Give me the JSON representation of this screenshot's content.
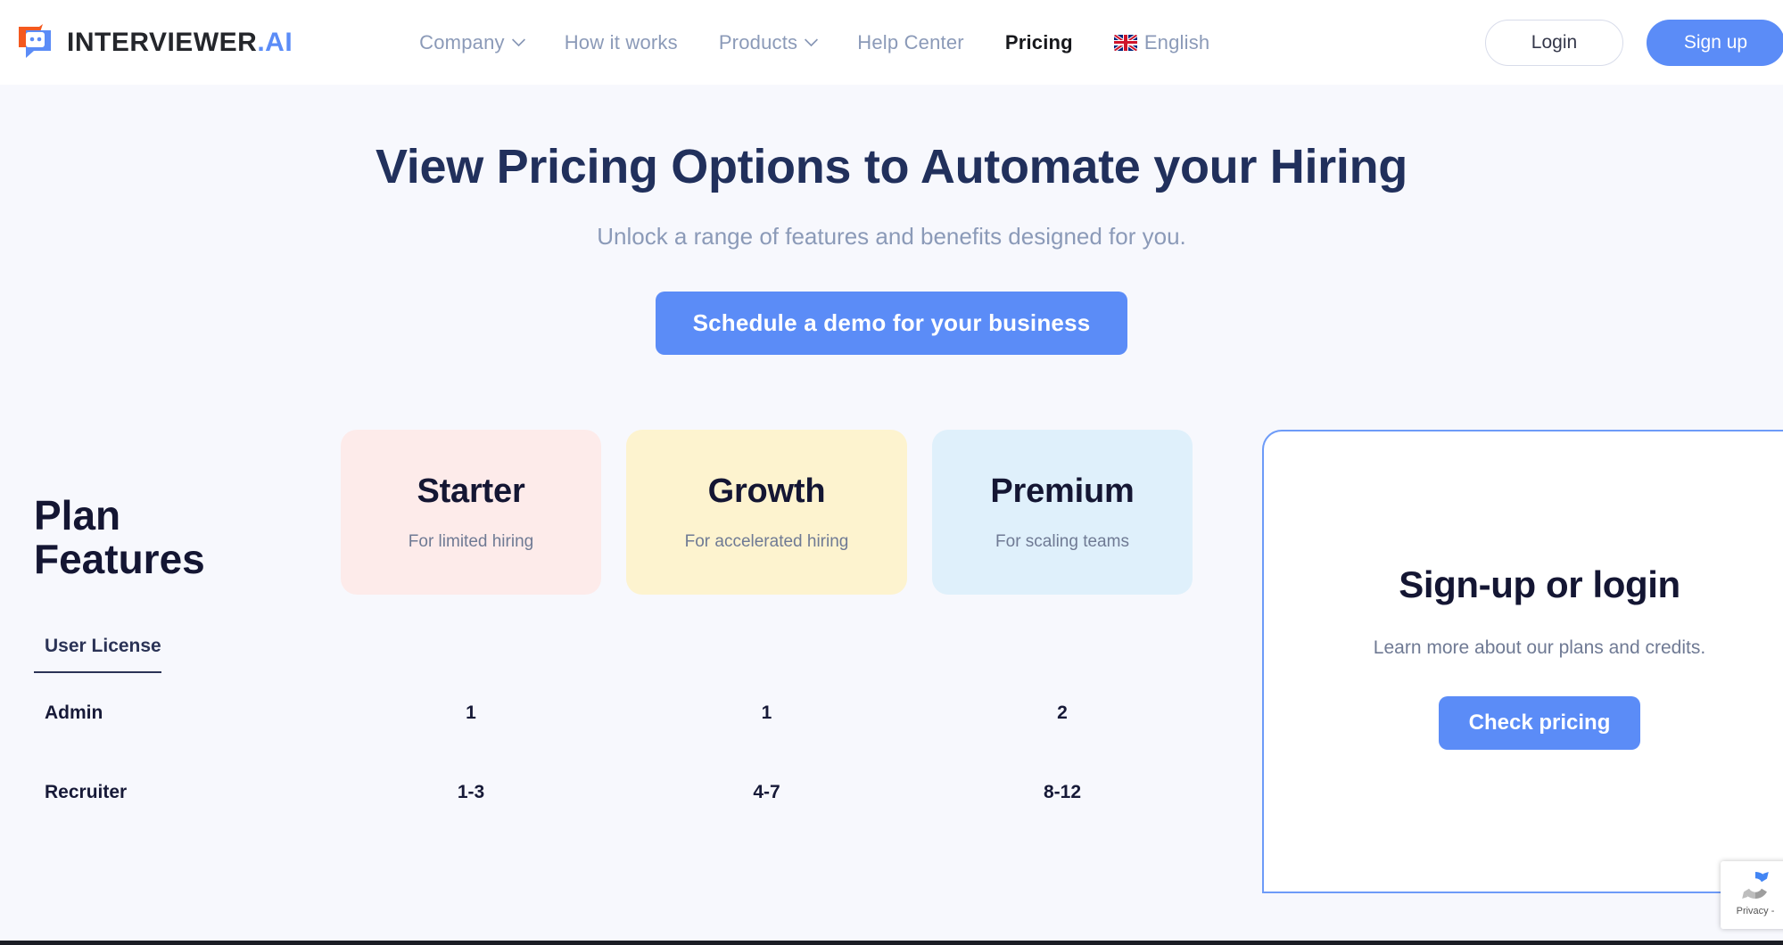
{
  "brand": {
    "name_main": "INTERVIEWER",
    "name_accent": ".AI",
    "logo_icon": "chat-bubble-robot-icon"
  },
  "nav": {
    "items": [
      {
        "label": "Company",
        "has_dropdown": true,
        "active": false
      },
      {
        "label": "How it works",
        "has_dropdown": false,
        "active": false
      },
      {
        "label": "Products",
        "has_dropdown": true,
        "active": false
      },
      {
        "label": "Help Center",
        "has_dropdown": false,
        "active": false
      },
      {
        "label": "Pricing",
        "has_dropdown": false,
        "active": true
      }
    ],
    "language": {
      "label": "English",
      "flag_icon": "uk-flag-icon"
    },
    "login_label": "Login",
    "signup_label": "Sign up"
  },
  "hero": {
    "title": "View Pricing Options to Automate your Hiring",
    "subtitle": "Unlock a range of features and benefits designed for you.",
    "cta_label": "Schedule a demo for your business"
  },
  "pricing": {
    "features_label": "Plan\nFeatures",
    "plans": [
      {
        "name": "Starter",
        "tagline": "For limited hiring",
        "color": "#fdebea"
      },
      {
        "name": "Growth",
        "tagline": "For accelerated hiring",
        "color": "#fdf3cf"
      },
      {
        "name": "Premium",
        "tagline": "For scaling teams",
        "color": "#dff0fb"
      }
    ],
    "sections": [
      {
        "heading": "User License",
        "rows": [
          {
            "name": "Admin",
            "values": [
              "1",
              "1",
              "2"
            ]
          },
          {
            "name": "Recruiter",
            "values": [
              "1-3",
              "4-7",
              "8-12"
            ]
          }
        ]
      }
    ]
  },
  "signup_panel": {
    "title": "Sign-up or login",
    "subtitle": "Learn more about our plans and credits.",
    "cta_label": "Check pricing"
  },
  "recaptcha": {
    "privacy_label": "Privacy -",
    "icon": "recaptcha-icon"
  },
  "colors": {
    "accent_blue": "#5b8cf7",
    "nav_text": "#8b9ab8",
    "heading_navy": "#21305c",
    "page_bg": "#f7f8fd",
    "logo_orange": "#f4591f"
  }
}
